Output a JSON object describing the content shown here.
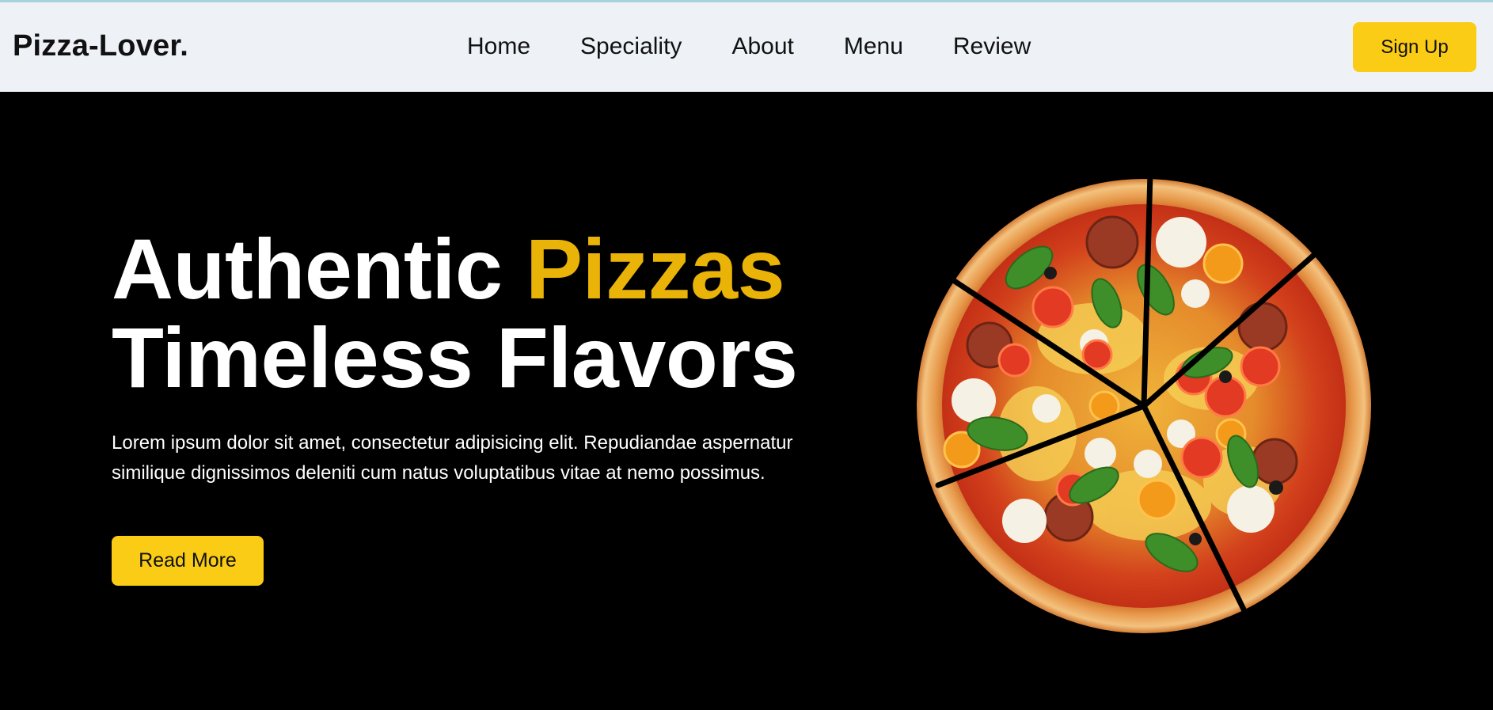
{
  "brand": {
    "logo": "Pizza-Lover."
  },
  "nav": {
    "links": [
      "Home",
      "Speciality",
      "About",
      "Menu",
      "Review"
    ],
    "signup_label": "Sign Up"
  },
  "hero": {
    "headline_line1_part1": "Authentic ",
    "headline_line1_accent": "Pizzas",
    "headline_line2": "Timeless Flavors",
    "description": "Lorem ipsum dolor sit amet, consectetur adipisicing elit. Repudiandae aspernatur similique dignissimos deleniti cum natus voluptatibus vitae at nemo possimus.",
    "read_more_label": "Read More",
    "image_name": "pizza-image"
  },
  "colors": {
    "accent": "#facc15",
    "accent_text": "#eab308",
    "nav_bg": "#eef2f7",
    "hero_bg": "#000000"
  }
}
